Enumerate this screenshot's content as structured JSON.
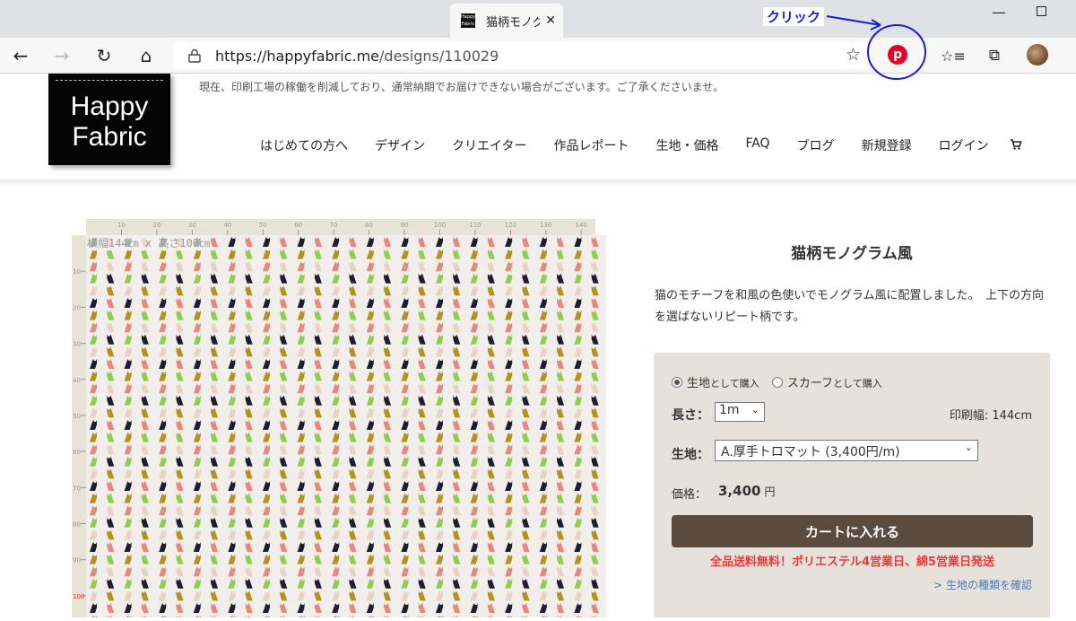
{
  "browser": {
    "tab_title": "猫柄モノグ",
    "favicon_text": "Happy Fabric",
    "tab_close": "✕",
    "url_host": "https://happyfabric.me",
    "url_path": "/designs/110029",
    "annotation": "クリック"
  },
  "icons": {
    "back": "←",
    "forward": "→",
    "reload": "↻",
    "home": "⌂",
    "star": "☆",
    "pinterest": "p",
    "favorites": "☆≡",
    "collections": "⧉",
    "cart": "🛒",
    "min": "—"
  },
  "notice": "現在、印刷工場の稼働を削減しており、通常納期でお届けできない場合がございます。ご了承くださいませ。",
  "logo": {
    "line1": "Happy",
    "line2": "Fabric"
  },
  "nav": [
    "はじめての方へ",
    "デザイン",
    "クリエイター",
    "作品レポート",
    "生地・価格",
    "FAQ",
    "ブログ",
    "新規登録",
    "ログイン"
  ],
  "preview": {
    "size_label": "横幅144㎝ x 高さ100㎝",
    "top_ticks": [
      "10",
      "20",
      "30",
      "40",
      "50",
      "60",
      "70",
      "80",
      "90",
      "100",
      "110",
      "120",
      "130",
      "140"
    ],
    "left_ticks": [
      "10",
      "20",
      "30",
      "40",
      "50",
      "60",
      "70",
      "80",
      "90",
      "100"
    ],
    "colors": [
      "#1e1e30",
      "#b59120",
      "#e9887a",
      "#8fce4c",
      "#e8d2c2"
    ]
  },
  "product": {
    "title": "猫柄モノグラム風",
    "description": "猫のモチーフを和風の色使いでモノグラム風に配置しました。　上下の方向を選ばないリピート柄です。",
    "option_fabric": "生地",
    "option_fabric_suffix": "として購入",
    "option_scarf": "スカーフ",
    "option_scarf_suffix": "として購入",
    "length_label": "長さ：",
    "length_value": "1m",
    "print_width": "印刷幅: 144cm",
    "fabric_label": "生地：",
    "fabric_value": "A.厚手トロマット (3,400円/m)",
    "price_label": "価格：",
    "price_value": "3,400",
    "price_unit": "円",
    "cart_button": "カートに入れる",
    "shipping": "全品送料無料！ポリエステル4営業日、綿5営業日発送",
    "fabric_link": "> 生地の種類を確認"
  }
}
